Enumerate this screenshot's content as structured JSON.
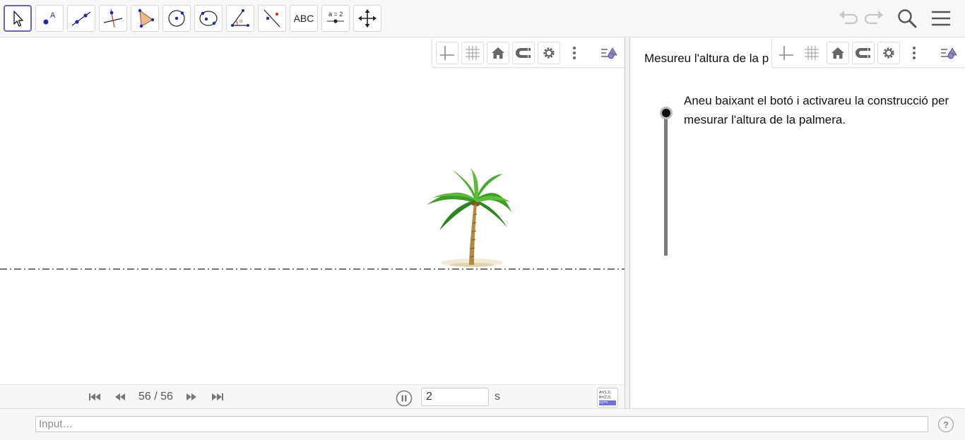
{
  "toolbar": {
    "tools": [
      {
        "name": "move-tool",
        "icon": "arrow-pointer-icon"
      },
      {
        "name": "point-tool",
        "icon": "point-icon"
      },
      {
        "name": "line-tool",
        "icon": "line-icon"
      },
      {
        "name": "perpendicular-line-tool",
        "icon": "perpendicular-line-icon"
      },
      {
        "name": "polygon-tool",
        "icon": "polygon-icon"
      },
      {
        "name": "circle-tool",
        "icon": "circle-center-point-icon"
      },
      {
        "name": "conic-tool",
        "icon": "ellipse-icon"
      },
      {
        "name": "angle-tool",
        "icon": "angle-icon"
      },
      {
        "name": "reflect-tool",
        "icon": "reflect-icon"
      },
      {
        "name": "text-tool",
        "icon": "text-icon"
      },
      {
        "name": "slider-tool",
        "icon": "slider-icon"
      },
      {
        "name": "move-graphics-view-tool",
        "icon": "move-view-icon"
      }
    ],
    "text_tool_label": "ABC",
    "slider_tool_label": "a = 2",
    "selected_tool": "move-tool",
    "right_icons": [
      "undo-icon",
      "redo-icon",
      "search-icon",
      "menu-icon"
    ]
  },
  "graphics1": {
    "style_bar_icons": [
      "axes-icon",
      "grid-icon",
      "home-icon",
      "snap-icon",
      "gear-icon",
      "more-vert-icon",
      "view-menu-icon"
    ]
  },
  "animation_bar": {
    "counter": "56 / 56",
    "speed_value": "2",
    "speed_unit": "s",
    "algebra_toggle_lines": [
      "A=(1,1)",
      "B=(2,2)",
      "a:y=x"
    ]
  },
  "graphics2": {
    "title_text": "Mesureu l'altura de la p",
    "instruction": "Aneu baixant el botó i activareu la construcció per mesurar l'altura de la palmera.",
    "slider_value": 0,
    "style_bar_icons": [
      "axes-icon",
      "grid-icon",
      "home-icon",
      "snap-icon",
      "gear-icon",
      "more-vert-icon",
      "view-menu-icon"
    ]
  },
  "input_bar": {
    "placeholder": "Input…",
    "help_label": "?"
  },
  "colors": {
    "accent": "#6a63b6",
    "tool_blue": "#1e2aa8",
    "ground_line": "#222222",
    "palm_trunk": "#b38a3e",
    "palm_leaf": "#3f9b2a"
  }
}
